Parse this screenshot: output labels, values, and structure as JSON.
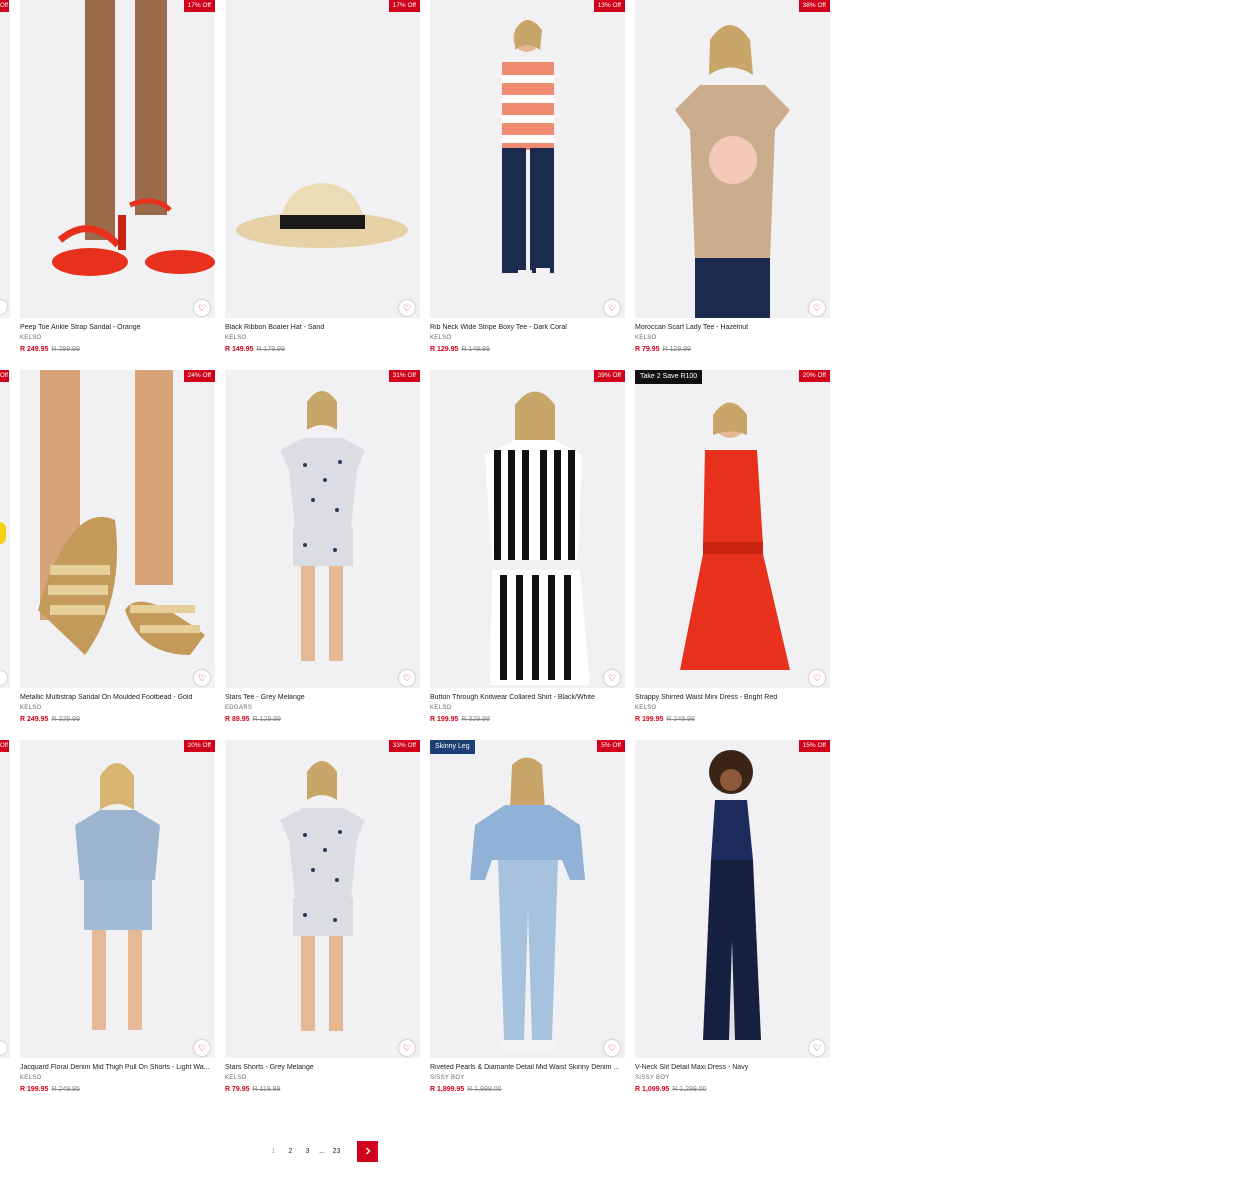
{
  "wishlist_icon": "heart-outline-icon",
  "products": [
    {
      "title": "Peep Toe Ankle Strap Sandal - Orange",
      "brand": "KELSO",
      "price": "R 249.95",
      "was": "R 299.99",
      "discount": "17% Off",
      "promo": "",
      "art": "sandal-red"
    },
    {
      "title": "Black Ribbon Boater Hat - Sand",
      "brand": "KELSO",
      "price": "R 149.95",
      "was": "R 179.99",
      "discount": "17% Off",
      "promo": "",
      "art": "hat"
    },
    {
      "title": "Rib Neck Wide Stripe Boxy Tee - Dark Coral",
      "brand": "KELSO",
      "price": "R 129.95",
      "was": "R 149.99",
      "discount": "13% Off",
      "promo": "",
      "art": "stripe-tee"
    },
    {
      "title": "Moroccan Scarf Lady Tee - Hazelnut",
      "brand": "KELSO",
      "price": "R 79.95",
      "was": "R 129.99",
      "discount": "38% Off",
      "promo": "",
      "art": "beige-tee"
    },
    {
      "title": "Metallic Multistrap Sandal On Moulded Footbead - Gold",
      "brand": "KELSO",
      "price": "R 249.95",
      "was": "R 329.99",
      "discount": "24% Off",
      "promo": "",
      "art": "sandal-gold"
    },
    {
      "title": "Stars Tee - Grey Melange",
      "brand": "EDGARS",
      "price": "R 89.95",
      "was": "R 129.99",
      "discount": "31% Off",
      "promo": "",
      "art": "stars-set"
    },
    {
      "title": "Button Through Knitwear Collared Shirt - Black/White",
      "brand": "KELSO",
      "price": "R 199.95",
      "was": "R 329.99",
      "discount": "39% Off",
      "promo": "",
      "art": "knit-stripe"
    },
    {
      "title": "Strappy Shirred Waist Mini Dress - Bright Red",
      "brand": "KELSO",
      "price": "R 199.95",
      "was": "R 249.99",
      "discount": "20% Off",
      "promo": "Take 2 Save R100",
      "promo_style": "dark",
      "art": "red-dress"
    },
    {
      "title": "Jacquard Floral Denim Mid Thigh Pull On Shorts - Light Wa...",
      "brand": "KELSO",
      "price": "R 199.95",
      "was": "R 249.95",
      "discount": "20% Off",
      "promo": "",
      "art": "denim-shorts"
    },
    {
      "title": "Stars Shorts - Grey Melange",
      "brand": "KELSO",
      "price": "R 79.95",
      "was": "R 119.99",
      "discount": "33% Off",
      "promo": "",
      "art": "stars-set"
    },
    {
      "title": "Riveted Pearls & Diamante Detail Mid Waist Skinny Denim ...",
      "brand": "SISSY BOY",
      "price": "R 1,899.95",
      "was": "R 1,999.00",
      "discount": "5% Off",
      "promo": "Skinny Leg",
      "promo_style": "navy",
      "art": "denim-set"
    },
    {
      "title": "V-Neck Slit Detail Maxi Dress - Navy",
      "brand": "SISSY BOY",
      "price": "R 1,099.95",
      "was": "R 1,299.00",
      "discount": "15% Off",
      "promo": "",
      "art": "navy-dress"
    }
  ],
  "edge_column": {
    "discount": "Off"
  },
  "pagination": {
    "current": "1",
    "pages": [
      "2",
      "3"
    ],
    "ellipsis": "...",
    "last": "23",
    "next_icon": "chevron-right-icon"
  }
}
